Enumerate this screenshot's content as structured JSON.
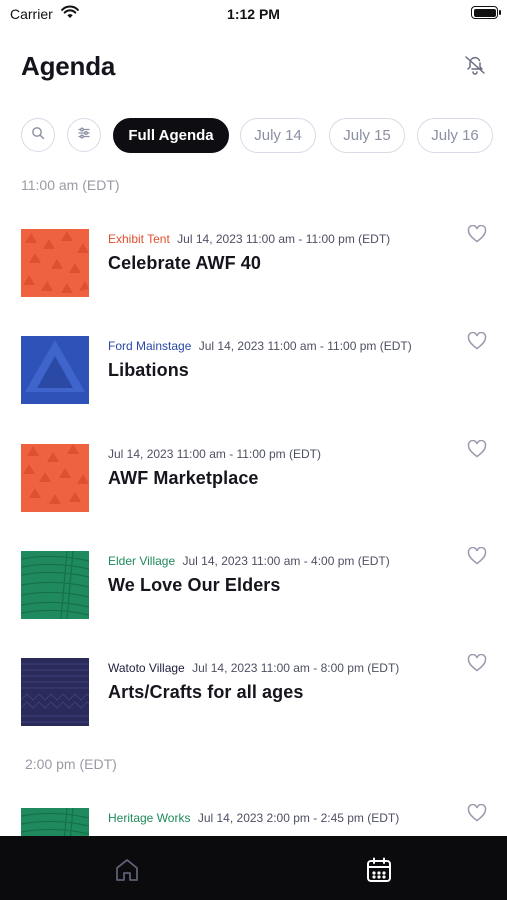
{
  "status_bar": {
    "carrier": "Carrier",
    "time": "1:12 PM"
  },
  "header": {
    "title": "Agenda",
    "bell_icon": "bell-slash-icon"
  },
  "filters": {
    "search_icon": "search-icon",
    "filter_icon": "sliders-icon",
    "chips": [
      {
        "label": "Full Agenda",
        "active": true
      },
      {
        "label": "July 14",
        "active": false
      },
      {
        "label": "July 15",
        "active": false
      },
      {
        "label": "July 16",
        "active": false
      }
    ]
  },
  "sections": [
    {
      "time": "11:00 am (EDT)",
      "events": [
        {
          "venue": "Exhibit Tent",
          "venue_color": "#e0502c",
          "when": "Jul 14, 2023 11:00 am - 11:00 pm (EDT)",
          "title": "Celebrate AWF 40",
          "thumb_color": "#ee6240"
        },
        {
          "venue": "Ford Mainstage",
          "venue_color": "#2a4aa6",
          "when": "Jul 14, 2023 11:00 am - 11:00 pm (EDT)",
          "title": "Libations",
          "thumb_color": "#2e52b8"
        },
        {
          "venue": "",
          "venue_color": "#4e5063",
          "when": "Jul 14, 2023 11:00 am - 11:00 pm (EDT)",
          "title": "AWF Marketplace",
          "thumb_color": "#ee6240"
        },
        {
          "venue": "Elder Village",
          "venue_color": "#1f8a5a",
          "when": "Jul 14, 2023 11:00 am -  4:00 pm (EDT)",
          "title": "We Love Our Elders",
          "thumb_color": "#1f8a5e"
        },
        {
          "venue": "Watoto Village",
          "venue_color": "#1e1f3d",
          "when": "Jul 14, 2023 11:00 am -  8:00 pm (EDT)",
          "title": "Arts/Crafts for all ages",
          "thumb_color": "#2a2b5a"
        }
      ]
    },
    {
      "time": "2:00 pm (EDT)",
      "events": [
        {
          "venue": "Heritage Works",
          "venue_color": "#1f8a5a",
          "when": "Jul 14, 2023  2:00 pm -  2:45 pm (EDT)",
          "title": "",
          "thumb_color": "#1f8a5e"
        }
      ]
    }
  ],
  "tab_bar": {
    "home_icon": "home-icon",
    "agenda_icon": "calendar-icon",
    "active": "agenda"
  }
}
